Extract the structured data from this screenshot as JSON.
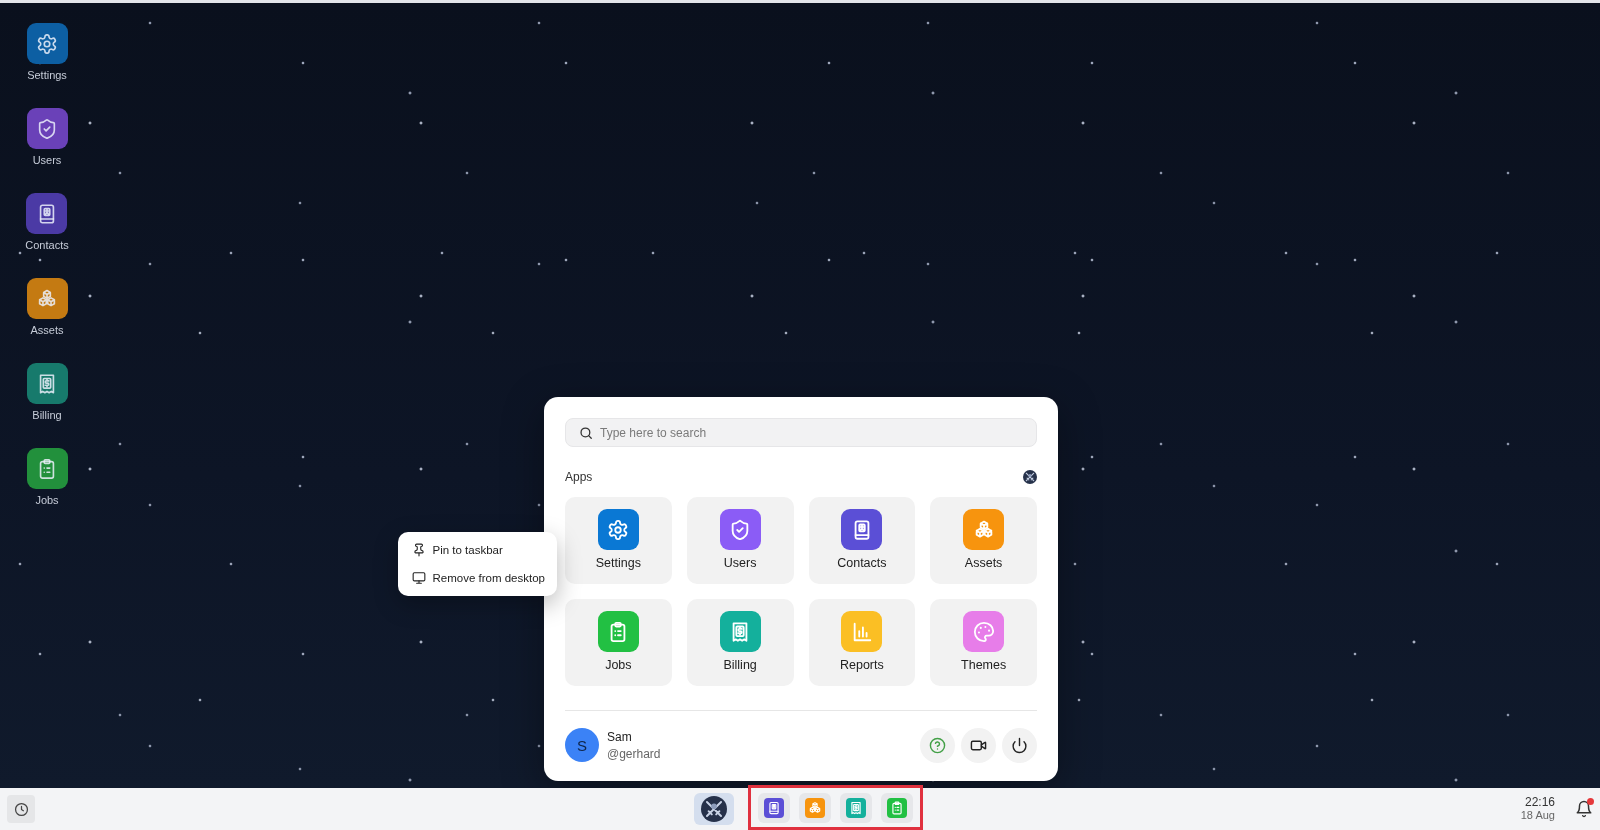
{
  "desktop": {
    "shortcuts": [
      {
        "label": "Settings",
        "kind": "settings",
        "color": "#0d5fa3"
      },
      {
        "label": "Users",
        "kind": "users",
        "color": "#6a41b8"
      },
      {
        "label": "Contacts",
        "kind": "contacts",
        "color": "#4b3aa5"
      },
      {
        "label": "Assets",
        "kind": "assets",
        "color": "#c47a12"
      },
      {
        "label": "Billing",
        "kind": "billing",
        "color": "#177a6c"
      },
      {
        "label": "Jobs",
        "kind": "jobs",
        "color": "#22903c"
      }
    ]
  },
  "start_menu": {
    "search": {
      "placeholder": "Type here to search"
    },
    "section_title": "Apps",
    "apps": [
      {
        "label": "Settings",
        "kind": "settings",
        "color": "#0a78d4",
        "context_menu": {
          "items": [
            {
              "label": "Pin to taskbar",
              "kind": "pin"
            },
            {
              "label": "Remove from desktop",
              "kind": "monitor"
            }
          ]
        }
      },
      {
        "label": "Users",
        "kind": "users",
        "color": "#8b5cf6"
      },
      {
        "label": "Contacts",
        "kind": "contacts",
        "color": "#5b4fd6"
      },
      {
        "label": "Assets",
        "kind": "assets",
        "color": "#f7940e"
      },
      {
        "label": "Jobs",
        "kind": "jobs",
        "color": "#22c043"
      },
      {
        "label": "Billing",
        "kind": "billing",
        "color": "#14b09c"
      },
      {
        "label": "Reports",
        "kind": "reports",
        "color": "#fbbf24"
      },
      {
        "label": "Themes",
        "kind": "themes",
        "color": "#e77de9"
      }
    ],
    "user": {
      "initial": "S",
      "name": "Sam",
      "handle": "@gerhard"
    },
    "actions": [
      {
        "kind": "help",
        "color": "#43a047"
      },
      {
        "kind": "video",
        "color": "#222222"
      },
      {
        "kind": "power",
        "color": "#222222"
      }
    ]
  },
  "taskbar": {
    "pinned": {
      "highlighted": true,
      "apps": [
        {
          "kind": "contacts",
          "color": "#5b4fd6"
        },
        {
          "kind": "assets",
          "color": "#f7940e"
        },
        {
          "kind": "billing",
          "color": "#14b09c"
        },
        {
          "kind": "jobs",
          "color": "#22c043"
        }
      ]
    },
    "time": "22:16",
    "date": "18 Aug",
    "notifications": {
      "unread": true
    }
  }
}
